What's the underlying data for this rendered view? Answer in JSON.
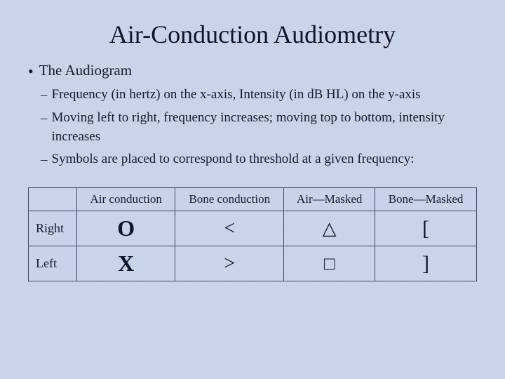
{
  "slide": {
    "title": "Air-Conduction Audiometry",
    "bullet_label": "The Audiogram",
    "sub_bullets": [
      "Frequency (in hertz) on the x-axis, Intensity (in dB HL) on the y-axis",
      "Moving left to right, frequency increases; moving top to bottom, intensity increases",
      "Symbols are placed to correspond to threshold at a given frequency:"
    ],
    "table": {
      "headers": [
        "",
        "Air conduction",
        "Bone conduction",
        "Air—Masked",
        "Bone—Masked"
      ],
      "rows": [
        {
          "label": "Right",
          "air_conduction": "O",
          "bone_conduction": "<",
          "air_masked": "△",
          "bone_masked": "["
        },
        {
          "label": "Left",
          "air_conduction": "X",
          "bone_conduction": ">",
          "air_masked": "□",
          "bone_masked": "]"
        }
      ]
    }
  }
}
